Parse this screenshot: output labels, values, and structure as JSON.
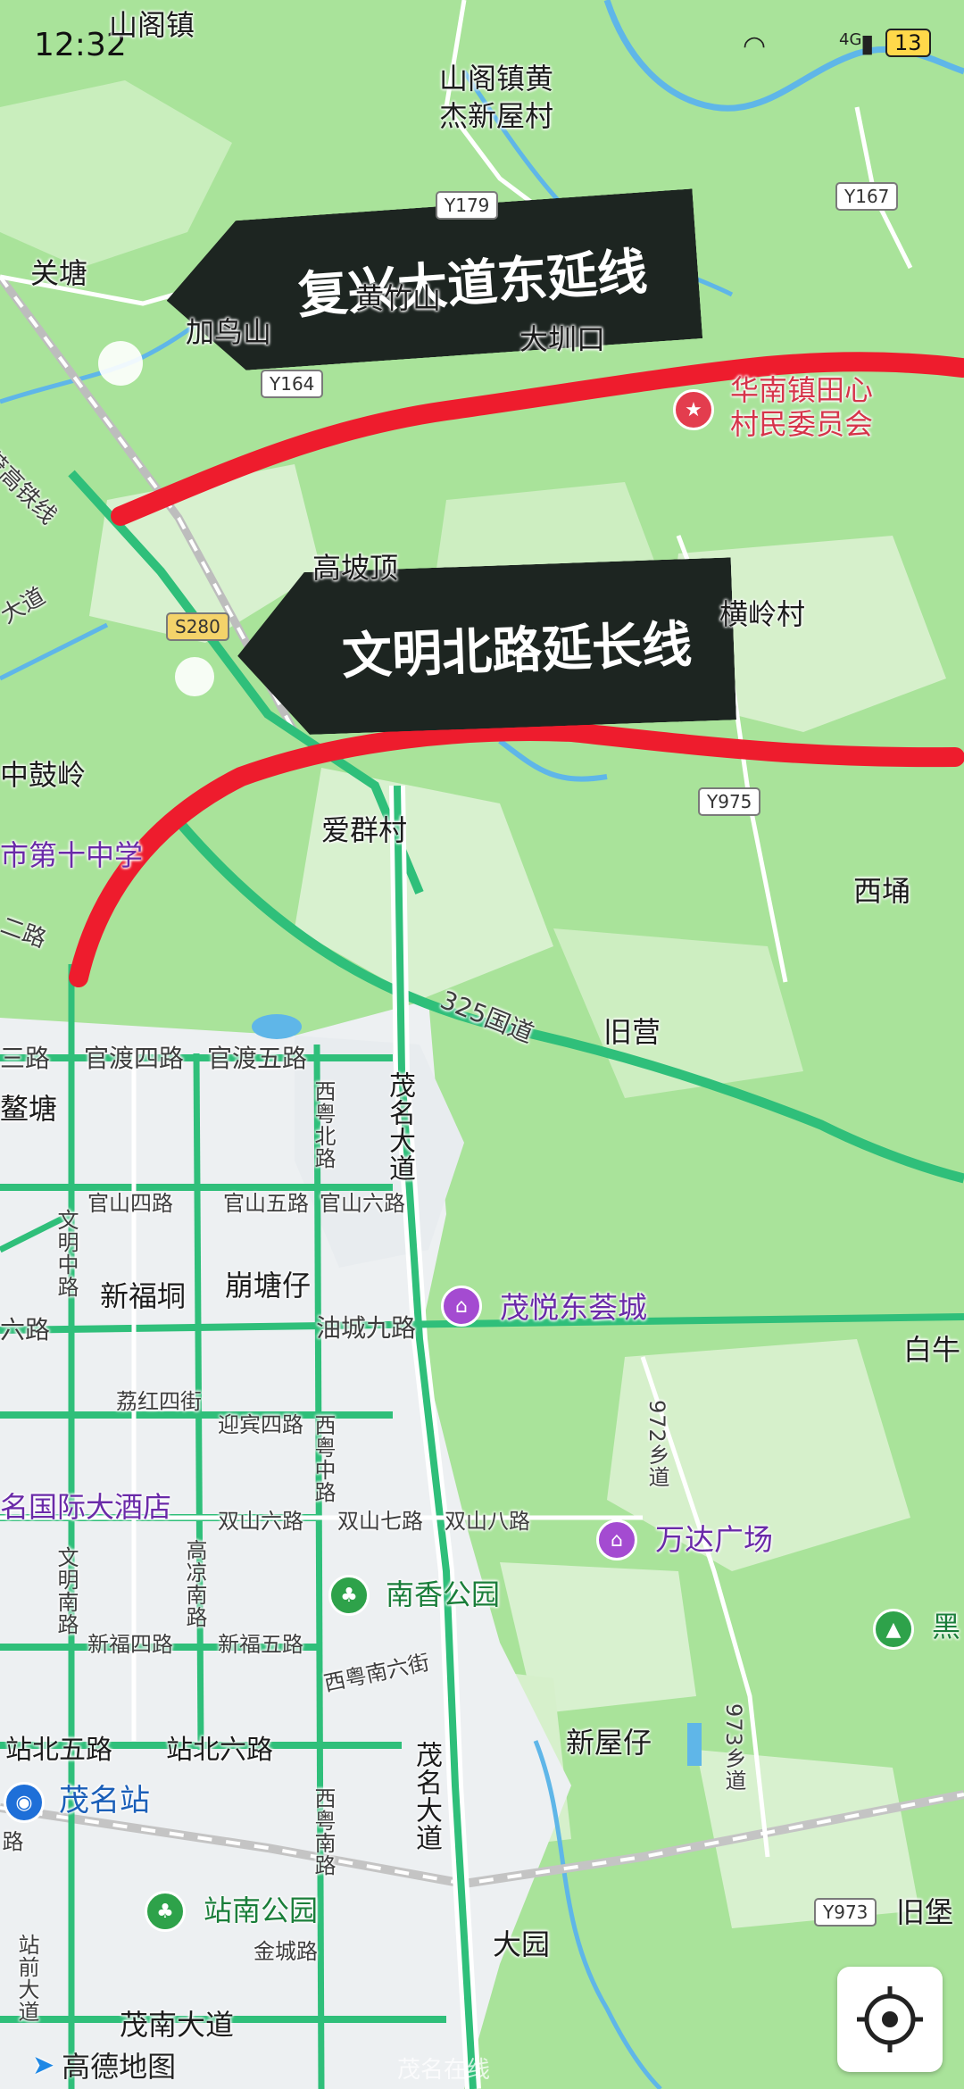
{
  "status_bar": {
    "time": "12:32",
    "battery": "13",
    "network": "4G"
  },
  "banners": [
    {
      "text": "复兴大道东延线"
    },
    {
      "text": "文明北路延长线"
    }
  ],
  "place_labels": [
    "山阁镇",
    "山阁镇黄",
    "杰新屋村",
    "关塘",
    "黄竹山",
    "加鸟山",
    "大圳口",
    "高坡顶",
    "横岭村",
    "中鼓岭",
    "爱群村",
    "市第十中学",
    "西埇",
    "旧营",
    "三路",
    "官渡四路",
    "官渡五路",
    "鳌塘",
    "官山四路",
    "官山五路",
    "官山六路",
    "新福垌",
    "崩塘仔",
    "六路",
    "油城九路",
    "白牛",
    "荔红四街",
    "迎宾四路",
    "名国际大酒店",
    "双山六路",
    "双山七路",
    "双山八路",
    "新福四路",
    "新福五路",
    "西粤南六街",
    "站北五路",
    "站北六路",
    "新屋仔",
    "金城路",
    "大园",
    "旧堡",
    "黑",
    "茂高铁线",
    "大道",
    "二路"
  ],
  "vertical_labels": [
    "西粤北路",
    "茂名大道",
    "文明中路",
    "西粤中路",
    "文明南路",
    "高凉南路",
    "972乡道",
    "973乡道",
    "茂名大道",
    "西粤南路",
    "站前大道",
    "路"
  ],
  "road_shields": [
    "Y179",
    "Y167",
    "Y164",
    "S280",
    "Y975",
    "Y973"
  ],
  "highway_label": "325国道",
  "pois": [
    {
      "name": "茂悦东荟城",
      "type": "mall"
    },
    {
      "name": "万达广场",
      "type": "mall"
    },
    {
      "name": "南香公园",
      "type": "park"
    },
    {
      "name": "站南公园",
      "type": "park"
    },
    {
      "name": "茂名站",
      "type": "station"
    },
    {
      "name": "华南镇田心",
      "type": "committee"
    },
    {
      "name": "村民委员会",
      "type": "committee"
    }
  ],
  "bottom": {
    "road": "茂南大道",
    "logo": "高德地图",
    "watermark": "茂名在线"
  },
  "colors": {
    "land": "#a9e39a",
    "urban": "#edf0f2",
    "road": "#2fbf7a",
    "highlight": "#ee1c2d",
    "banner": "#1d2521",
    "water": "#5fb6e8"
  }
}
